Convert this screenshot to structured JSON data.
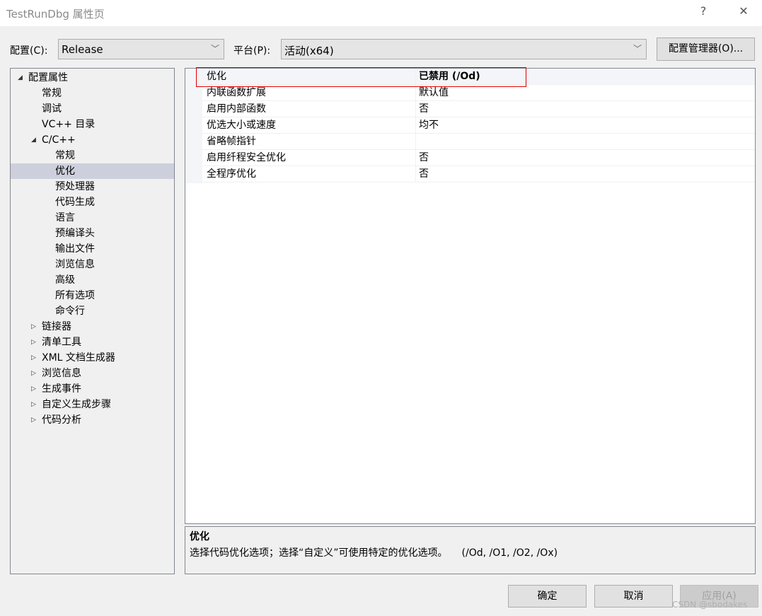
{
  "window": {
    "title": "TestRunDbg 属性页",
    "help": "?",
    "close": "✕"
  },
  "toolbar": {
    "config_label": "配置(C):",
    "config_value": "Release",
    "platform_label": "平台(P):",
    "platform_value": "活动(x64)",
    "config_manager": "配置管理器(O)..."
  },
  "tree": [
    {
      "label": "配置属性",
      "level": 0,
      "arrow": "◢"
    },
    {
      "label": "常规",
      "level": 1
    },
    {
      "label": "调试",
      "level": 1
    },
    {
      "label": "VC++ 目录",
      "level": 1
    },
    {
      "label": "C/C++",
      "level": 1,
      "arrow": "◢"
    },
    {
      "label": "常规",
      "level": 2
    },
    {
      "label": "优化",
      "level": 2,
      "selected": true
    },
    {
      "label": "预处理器",
      "level": 2
    },
    {
      "label": "代码生成",
      "level": 2
    },
    {
      "label": "语言",
      "level": 2
    },
    {
      "label": "预编译头",
      "level": 2
    },
    {
      "label": "输出文件",
      "level": 2
    },
    {
      "label": "浏览信息",
      "level": 2
    },
    {
      "label": "高级",
      "level": 2
    },
    {
      "label": "所有选项",
      "level": 2
    },
    {
      "label": "命令行",
      "level": 2
    },
    {
      "label": "链接器",
      "level": 1,
      "arrow": "▷"
    },
    {
      "label": "清单工具",
      "level": 1,
      "arrow": "▷"
    },
    {
      "label": "XML 文档生成器",
      "level": 1,
      "arrow": "▷"
    },
    {
      "label": "浏览信息",
      "level": 1,
      "arrow": "▷"
    },
    {
      "label": "生成事件",
      "level": 1,
      "arrow": "▷"
    },
    {
      "label": "自定义生成步骤",
      "level": 1,
      "arrow": "▷"
    },
    {
      "label": "代码分析",
      "level": 1,
      "arrow": "▷"
    }
  ],
  "properties": [
    {
      "name": "优化",
      "value": "已禁用 (/Od)",
      "selected": true
    },
    {
      "name": "内联函数扩展",
      "value": "默认值"
    },
    {
      "name": "启用内部函数",
      "value": "否"
    },
    {
      "name": "优选大小或速度",
      "value": "均不"
    },
    {
      "name": "省略帧指针",
      "value": ""
    },
    {
      "name": "启用纤程安全优化",
      "value": "否"
    },
    {
      "name": "全程序优化",
      "value": "否"
    }
  ],
  "description": {
    "title": "优化",
    "text": "选择代码优化选项；选择“自定义”可使用特定的优化选项。",
    "switches": "(/Od, /O1, /O2, /Ox)"
  },
  "buttons": {
    "ok": "确定",
    "cancel": "取消",
    "apply": "应用(A)"
  },
  "watermark": "CSDN @sbodakes"
}
